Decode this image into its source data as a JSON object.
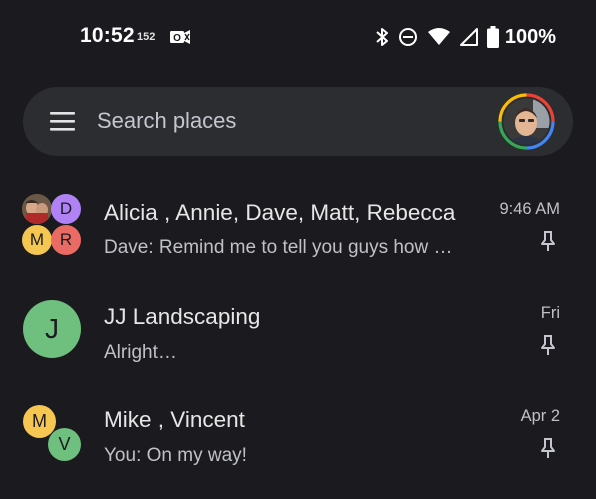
{
  "status_bar": {
    "time": "10:52",
    "small_text": "152",
    "battery_percent": "100%",
    "icons": [
      "notification-icon",
      "bluetooth-icon",
      "do-not-disturb-icon",
      "wifi-icon",
      "cellular-signal-icon",
      "battery-icon"
    ]
  },
  "search": {
    "placeholder": "Search places",
    "value": ""
  },
  "conversations": [
    {
      "name": "Alicia , Annie, Dave, Matt, Rebecca",
      "snippet": "Dave: Remind me to tell you guys how …",
      "time": "9:46 AM",
      "pinned": true,
      "avatars": [
        {
          "type": "photo"
        },
        {
          "initial": "D",
          "color": "#b082f5"
        },
        {
          "initial": "M",
          "color": "#f6c653"
        },
        {
          "initial": "R",
          "color": "#ea6b63"
        }
      ]
    },
    {
      "name": "JJ Landscaping",
      "snippet": "Alright…",
      "time": "Fri",
      "pinned": true,
      "avatars": [
        {
          "initial": "J",
          "color": "#6fbf7e"
        }
      ]
    },
    {
      "name": "Mike , Vincent",
      "snippet": "You: On my way!",
      "time": "Apr 2",
      "pinned": true,
      "avatars": [
        {
          "initial": "M",
          "color": "#f6c653"
        },
        {
          "initial": "V",
          "color": "#6fbf7e"
        }
      ]
    }
  ],
  "colors": {
    "background": "#1b1b1f",
    "searchbar": "#2c2d31"
  }
}
